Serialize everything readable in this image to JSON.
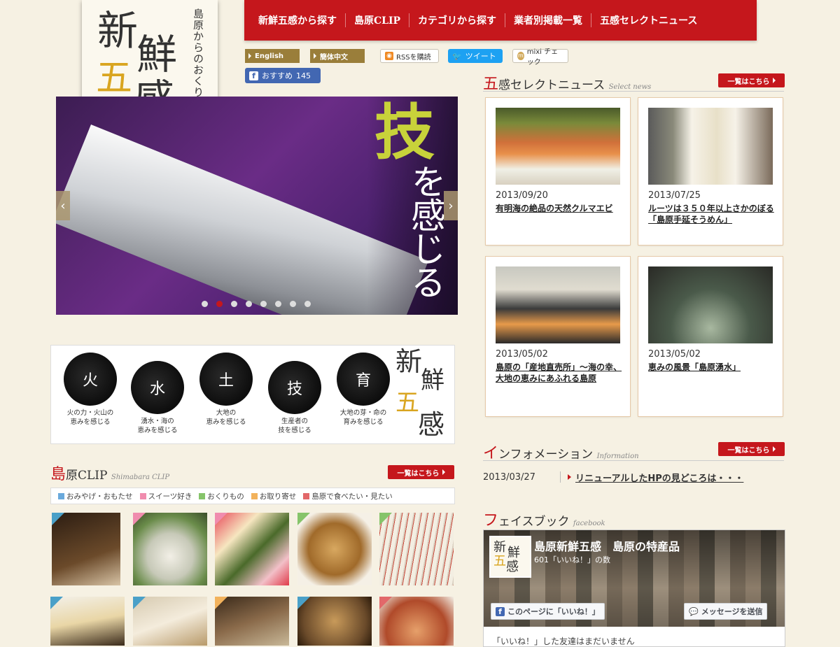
{
  "logo": {
    "main_chars": [
      "新",
      "鮮",
      "五",
      "感"
    ],
    "vertical_text": "島原からのおくりもの"
  },
  "nav": {
    "items": [
      "新鮮五感から探す",
      "島原CLIP",
      "カテゴリから探す",
      "業者別掲載一覧",
      "五感セレクトニュース"
    ]
  },
  "lang": {
    "english": "English",
    "chinese": "簡体中文"
  },
  "social": {
    "rss": "RSSを購読",
    "tweet": "ツイート",
    "mixi": "mixi チェック",
    "fb_recommend": "おすすめ",
    "fb_count": "145"
  },
  "hero": {
    "main_char": "技",
    "sub_text": "を感じる",
    "prev": "‹",
    "next": "›",
    "slide_count": 8,
    "active_slide": 2
  },
  "gokan": {
    "items": [
      {
        "char": "火",
        "caption_line1": "火の力・火山の",
        "caption_line2": "恵みを感じる"
      },
      {
        "char": "水",
        "caption_line1": "湧水・海の",
        "caption_line2": "恵みを感じる"
      },
      {
        "char": "土",
        "caption_line1": "大地の",
        "caption_line2": "恵みを感じる"
      },
      {
        "char": "技",
        "caption_line1": "生産者の",
        "caption_line2": "技を感じる"
      },
      {
        "char": "育",
        "caption_line1": "大地の芽・命の",
        "caption_line2": "育みを感じる"
      }
    ],
    "logo_chars": [
      "新",
      "鮮",
      "五",
      "感"
    ]
  },
  "clip": {
    "title_first": "島",
    "title_rest": "原CLIP",
    "title_sub": "Shimabara CLIP",
    "more": "一覧はこちら",
    "tags": [
      {
        "label": "おみやげ・おもたせ",
        "color": "#6aa9dc"
      },
      {
        "label": "スイーツ好き",
        "color": "#f08cae"
      },
      {
        "label": "おくりもの",
        "color": "#86c46a"
      },
      {
        "label": "お取り寄せ",
        "color": "#f2b25c"
      },
      {
        "label": "島原で食べたい・見たい",
        "color": "#e2686a"
      }
    ]
  },
  "news": {
    "title_first": "五",
    "title_rest": "感セレクトニュース",
    "title_sub": "Select news",
    "more": "一覧はこちら",
    "items": [
      {
        "date": "2013/09/20",
        "title": "有明海の絶品の天然クルマエビ"
      },
      {
        "date": "2013/07/25",
        "title": "ルーツは３５０年以上さかのぼる「島原手延そうめん」"
      },
      {
        "date": "2013/05/02",
        "title": "島原の「産地直売所」～海の幸、大地の恵みにあふれる島原"
      },
      {
        "date": "2013/05/02",
        "title": "恵みの風景「島原湧水」"
      }
    ]
  },
  "info": {
    "title_first": "イ",
    "title_rest": "ンフォメーション",
    "title_sub": "Information",
    "more": "一覧はこちら",
    "items": [
      {
        "date": "2013/03/27",
        "title": "リニューアルしたHPの見どころは・・・"
      }
    ]
  },
  "facebook": {
    "title_first": "フ",
    "title_rest": "ェイスブック",
    "title_sub": "facebook",
    "page_name": "島原新鮮五感　島原の特産品",
    "likes": "601「いいね！」の数",
    "like_button": "このページに「いいね！」",
    "message_button": "メッセージを送信",
    "friends_text": "「いいね！」した友達はまだいません"
  }
}
